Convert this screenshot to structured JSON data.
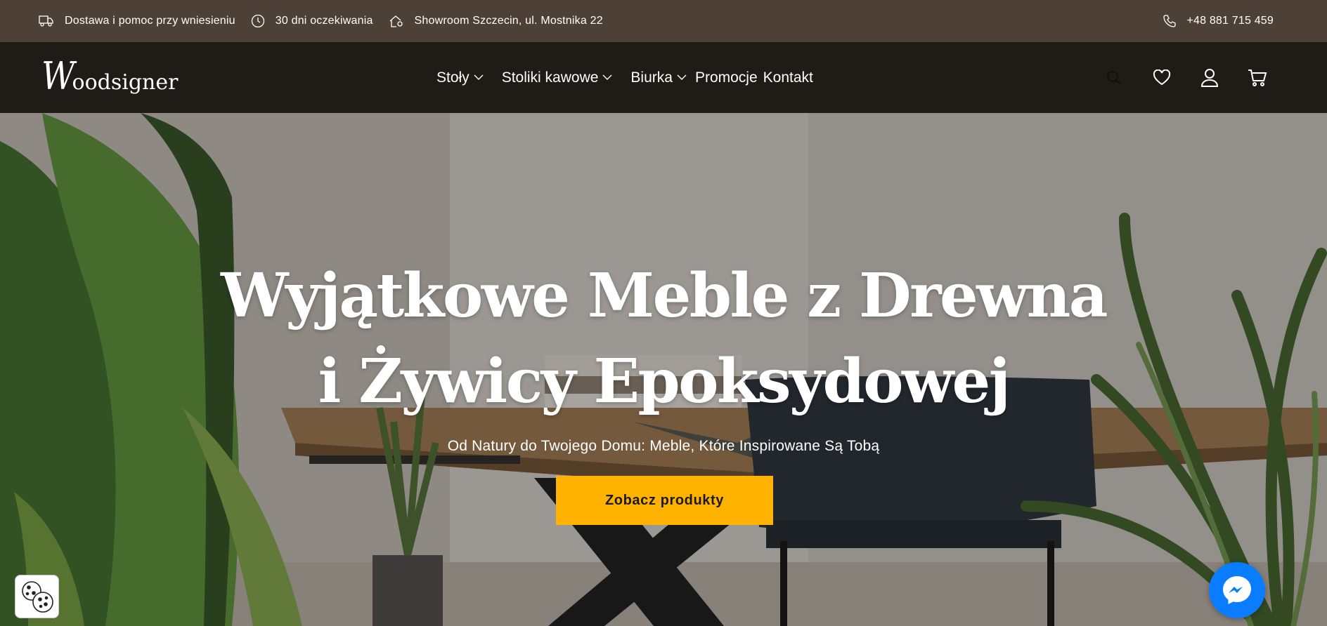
{
  "topbar": {
    "delivery": "Dostawa i pomoc przy wniesieniu",
    "waiting": "30 dni oczekiwania",
    "showroom": "Showroom Szczecin, ul. Mostnika 22",
    "phone": "+48 881 715 459"
  },
  "header": {
    "logo_initial": "W",
    "logo_rest": "oodsigner",
    "nav": [
      {
        "label": "Stoły"
      },
      {
        "label": "Stoliki kawowe"
      },
      {
        "label": "Biurka"
      },
      {
        "label": "Promocje"
      },
      {
        "label": "Kontakt"
      }
    ],
    "icons": [
      "search-icon",
      "heart-icon",
      "user-icon",
      "cart-icon"
    ]
  },
  "hero": {
    "title_line1": "Wyjątkowe Meble z Drewna",
    "title_line2": "i Żywicy Epoksydowej",
    "subtitle": "Od Natury do Twojego Domu: Meble, Które Inspirowane Są Tobą",
    "cta_label": "Zobacz produkty"
  },
  "colors": {
    "topbar_bg": "#4d4137",
    "header_bg": "#1f1b16",
    "accent": "#ffb200",
    "messenger": "#0a7cff"
  }
}
